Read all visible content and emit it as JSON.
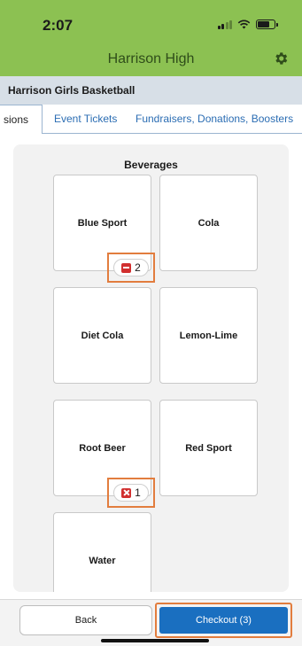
{
  "status": {
    "time": "2:07"
  },
  "header": {
    "school": "Harrison High"
  },
  "team": {
    "title": "Harrison Girls Basketball"
  },
  "tabs": [
    {
      "label": "Concessions",
      "visible_text": "sions",
      "active": true
    },
    {
      "label": "Event Tickets",
      "active": false
    },
    {
      "label": "Fundraisers, Donations, Boosters",
      "active": false
    }
  ],
  "section": {
    "title": "Beverages"
  },
  "items": [
    {
      "label": "Blue Sport",
      "quantity": "2",
      "qty_icon": "minus-icon"
    },
    {
      "label": "Cola"
    },
    {
      "label": "Diet Cola"
    },
    {
      "label": "Lemon-Lime"
    },
    {
      "label": "Root Beer",
      "quantity": "1",
      "qty_icon": "remove-icon"
    },
    {
      "label": "Red Sport"
    },
    {
      "label": "Water"
    }
  ],
  "footer": {
    "back_label": "Back",
    "checkout_label": "Checkout (3)"
  },
  "colors": {
    "header_green": "#8cc152",
    "accent_blue": "#1a6fc0",
    "highlight_orange": "#e27d3e",
    "badge_red": "#d12f2f"
  }
}
